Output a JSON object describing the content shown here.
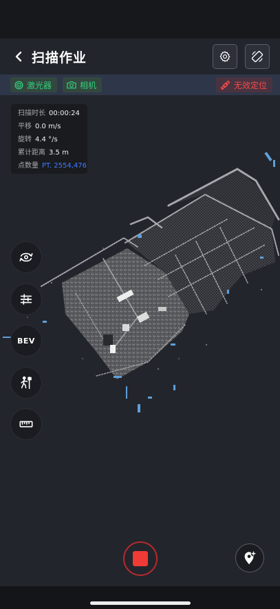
{
  "header": {
    "title": "扫描作业",
    "back_icon": "chevron-left-icon",
    "settings_icon": "gear-icon",
    "rotate_icon": "screen-rotate-icon"
  },
  "sensors": {
    "laser": {
      "label": "激光器",
      "icon": "laser-target-icon",
      "color": "#33d17a"
    },
    "camera": {
      "label": "相机",
      "icon": "camera-icon",
      "color": "#33d17a"
    },
    "positioning": {
      "label": "无效定位",
      "icon": "satellite-icon",
      "color": "#f24c4c"
    }
  },
  "stats": [
    {
      "label": "扫描时长",
      "value": "00:00:24"
    },
    {
      "label": "平移",
      "value": "0.0 m/s"
    },
    {
      "label": "旋转",
      "value": "4.4 °/s"
    },
    {
      "label": "累计距离",
      "value": "3.5 m"
    },
    {
      "label": "点数量",
      "value": "PT. 2554,476",
      "highlight": "#3d7bff"
    }
  ],
  "tools": {
    "reset_view_icon": "view-reset-icon",
    "adjust_icon": "sliders-icon",
    "bev_label": "BEV",
    "control_point_icon": "control-point-icon",
    "measure_icon": "ruler-icon"
  },
  "record_button": {
    "icon": "stop-icon",
    "color": "#f03a35"
  },
  "add_marker_icon": "add-location-icon",
  "colors": {
    "background": "#23252c",
    "accent_blue": "#3d7bff",
    "ok_green": "#33d17a",
    "error_red": "#f24c4c"
  }
}
